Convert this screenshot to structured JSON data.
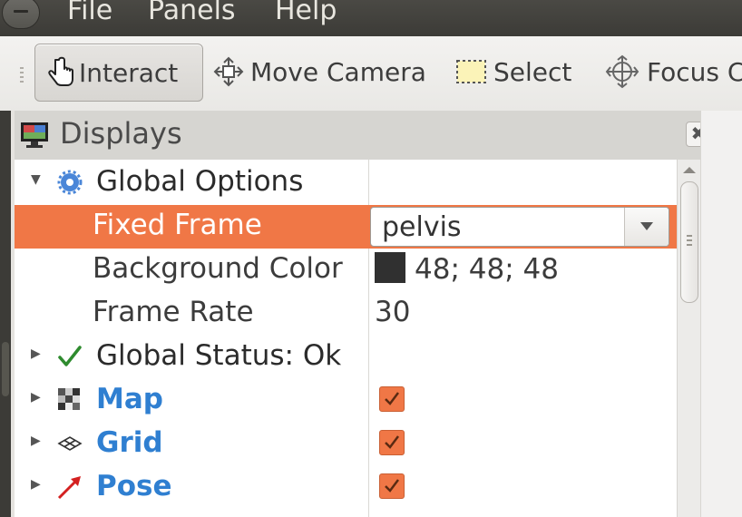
{
  "menubar": {
    "items": [
      "File",
      "Panels",
      "Help"
    ]
  },
  "toolbar": {
    "tools": [
      {
        "label": "Interact",
        "icon": "hand-pointer-icon",
        "active": true
      },
      {
        "label": "Move Camera",
        "icon": "move-arrows-icon",
        "active": false
      },
      {
        "label": "Select",
        "icon": "selection-box-icon",
        "active": false
      },
      {
        "label": "Focus Ca",
        "icon": "crosshair-icon",
        "active": false
      }
    ]
  },
  "displays_panel": {
    "title": "Displays",
    "close_icon": "close-icon",
    "tree": {
      "global_options": {
        "label": "Global Options",
        "icon": "gear-icon",
        "expanded": true,
        "fixed_frame": {
          "label": "Fixed Frame",
          "value": "pelvis",
          "selected": true
        },
        "background_color": {
          "label": "Background Color",
          "value": "48; 48; 48",
          "color": "#303030"
        },
        "frame_rate": {
          "label": "Frame Rate",
          "value": "30"
        }
      },
      "global_status": {
        "label": "Global Status: Ok",
        "icon": "checkmark-icon"
      },
      "displays": [
        {
          "label": "Map",
          "icon": "map-grid-icon",
          "enabled": true
        },
        {
          "label": "Grid",
          "icon": "grid-icon",
          "enabled": true
        },
        {
          "label": "Pose",
          "icon": "pose-arrow-icon",
          "enabled": true
        }
      ]
    }
  },
  "colors": {
    "selection": "#f07746",
    "display_link_blue": "#2f7fd1",
    "menubar_bg": "#3c3b37"
  }
}
